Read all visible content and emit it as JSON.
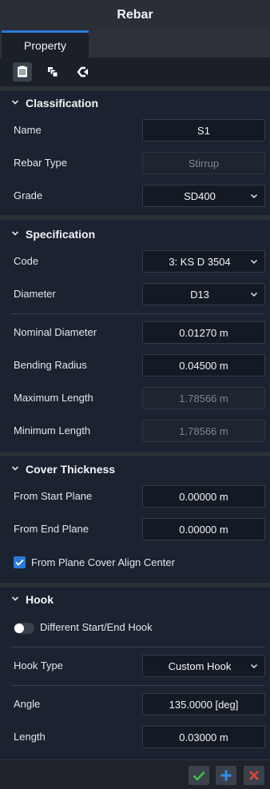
{
  "window": {
    "title": "Rebar"
  },
  "tabs": [
    {
      "label": "Property",
      "active": true
    }
  ],
  "toolbar": {
    "icons": [
      "property-list-icon",
      "layers-icon",
      "rebar-shape-icon"
    ]
  },
  "classification": {
    "title": "Classification",
    "name_label": "Name",
    "name_value": "S1",
    "rebar_type_label": "Rebar Type",
    "rebar_type_value": "Stirrup",
    "grade_label": "Grade",
    "grade_value": "SD400"
  },
  "specification": {
    "title": "Specification",
    "code_label": "Code",
    "code_value": "3: KS D 3504",
    "diameter_label": "Diameter",
    "diameter_value": "D13",
    "nominal_diameter_label": "Nominal Diameter",
    "nominal_diameter_value": "0.01270 m",
    "bending_radius_label": "Bending Radius",
    "bending_radius_value": "0.04500 m",
    "max_length_label": "Maximum Length",
    "max_length_value": "1.78566 m",
    "min_length_label": "Minimum Length",
    "min_length_value": "1.78566 m"
  },
  "cover_thickness": {
    "title": "Cover Thickness",
    "from_start_label": "From Start Plane",
    "from_start_value": "0.00000 m",
    "from_end_label": "From End Plane",
    "from_end_value": "0.00000 m",
    "align_center_label": "From Plane Cover Align Center",
    "align_center_checked": true
  },
  "hook": {
    "title": "Hook",
    "different_label": "Different Start/End Hook",
    "different_on": false,
    "hook_type_label": "Hook Type",
    "hook_type_value": "Custom Hook",
    "angle_label": "Angle",
    "angle_value": "135.0000 [deg]",
    "length_label": "Length",
    "length_value": "0.03000 m"
  },
  "colors": {
    "accent": "#2a7ad8",
    "ok": "#3fbf4a",
    "cancel": "#e0453a"
  }
}
